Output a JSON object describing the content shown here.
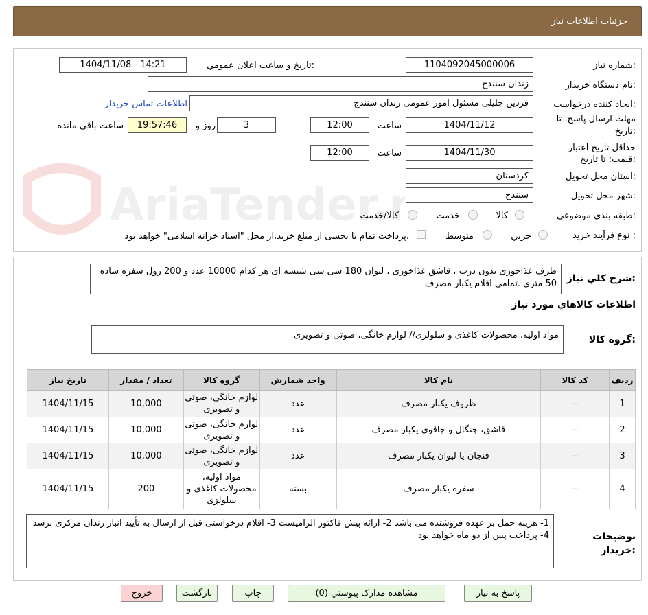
{
  "header": {
    "title": "جزئیات اطلاعات نیاز"
  },
  "form": {
    "need_number_label": "شماره نیاز:",
    "need_number": "1104092045000006",
    "announce_label": "تاریخ و ساعت اعلان عمومي:",
    "announce_value": "1404/11/08 - 14:21",
    "buyer_org_label": "نام دستگاه خريدار:",
    "buyer_org": "زندان سنندج",
    "requester_label": "ایجاد کننده درخواست:",
    "requester": "فردین جلیلی مسئول امور عمومی  زندان سنندج",
    "contact_link": "اطلاعات تماس خريدار",
    "deadline_label": "مهلت ارسال پاسخ: تا تاریخ:",
    "deadline_date": "1404/11/12",
    "time_label": "ساعت",
    "deadline_time": "12:00",
    "days": "3",
    "days_label": "روز و",
    "remaining": "19:57:46",
    "remaining_label": "ساعت باقي مانده",
    "validity_label": "حداقل تاريخ اعتبار قیمت: تا تاریخ:",
    "validity_date": "1404/11/30",
    "validity_time_label": "ساعت",
    "validity_time": "12:00",
    "province_label": "استان محل تحويل:",
    "province": "کردستان",
    "city_label": "شهر محل تحويل:",
    "city": "سنندج",
    "category_label": "طبقه بندی موضوعی:",
    "category_options": [
      "کالا",
      "خدمت",
      "کالا/خدمت"
    ],
    "process_label": "نوع فرآیند خرید :",
    "process_options": [
      "جزیي",
      "متوسط"
    ],
    "payment_note": "پرداخت تمام یا بخشی از مبلغ خرید،از محل \"اسناد خزانه اسلامی\" خواهد بود."
  },
  "description": {
    "label": "شرح کلي نياز:",
    "text": "ظرف غذاخوری بدون درب ، قاشق غذاخوری  ، لیوان 180 سی سی  شیشه ای هر کدام 10000 عدد و 200 رول سفره ساده  50 متری .تمامی اقلام یکبار مصرف"
  },
  "goods_info_title": "اطلاعات کالاهاي مورد نياز",
  "goods_group": {
    "label": "گروه کالا:",
    "value": "مواد اولیه، محصولات کاغذی و سلولزی// لوازم خانگی، صوتی و تصویری"
  },
  "table": {
    "headers": [
      "رديف",
      "کد کالا",
      "نام کالا",
      "واحد شمارش",
      "گروه کالا",
      "تعداد / مقدار",
      "تاریخ نیاز"
    ],
    "rows": [
      {
        "n": "1",
        "code": "--",
        "name": "ظروف یکبار مصرف",
        "unit": "عدد",
        "group": "لوازم خانگی، صوتی و تصویری",
        "qty": "10,000",
        "date": "1404/11/15"
      },
      {
        "n": "2",
        "code": "--",
        "name": "قاشق، چنگال و چاقوی یکبار مصرف",
        "unit": "عدد",
        "group": "لوازم خانگی، صوتی و تصویری",
        "qty": "10,000",
        "date": "1404/11/15"
      },
      {
        "n": "3",
        "code": "--",
        "name": "فنجان یا لیوان یکبار مصرف",
        "unit": "عدد",
        "group": "لوازم خانگی، صوتی و تصویری",
        "qty": "10,000",
        "date": "1404/11/15"
      },
      {
        "n": "4",
        "code": "--",
        "name": "سفره یکبار مصرف",
        "unit": "بسته",
        "group": "مواد اولیه، محصولات کاغذی و سلولزی",
        "qty": "200",
        "date": "1404/11/15"
      }
    ]
  },
  "buyer_notes": {
    "label": "توضيحات خريدار:",
    "text": "1- هزینه حمل بر عهده فروشنده می باشد 2- ارائه پیش فاکتور الزامیست 3- اقلام درخواستی قبل از ارسال به تأیید انبار زندان مرکزی برسد 4- پرداخت پس از دو ماه خواهد بود"
  },
  "buttons": {
    "reply": "پاسخ به نياز",
    "attachments": "مشاهده مدارک پيوستي (0)",
    "print": "چاپ",
    "back": "بازگشت",
    "exit": "خروج"
  },
  "watermark": "AriaTender.neT",
  "colors": {
    "header_bg": "#8a6a45",
    "link": "#1a44c8",
    "exit_btn": "#fbd3d3",
    "action_btn": "#e8f7e0",
    "remaining_bg": "#ffffcc"
  }
}
